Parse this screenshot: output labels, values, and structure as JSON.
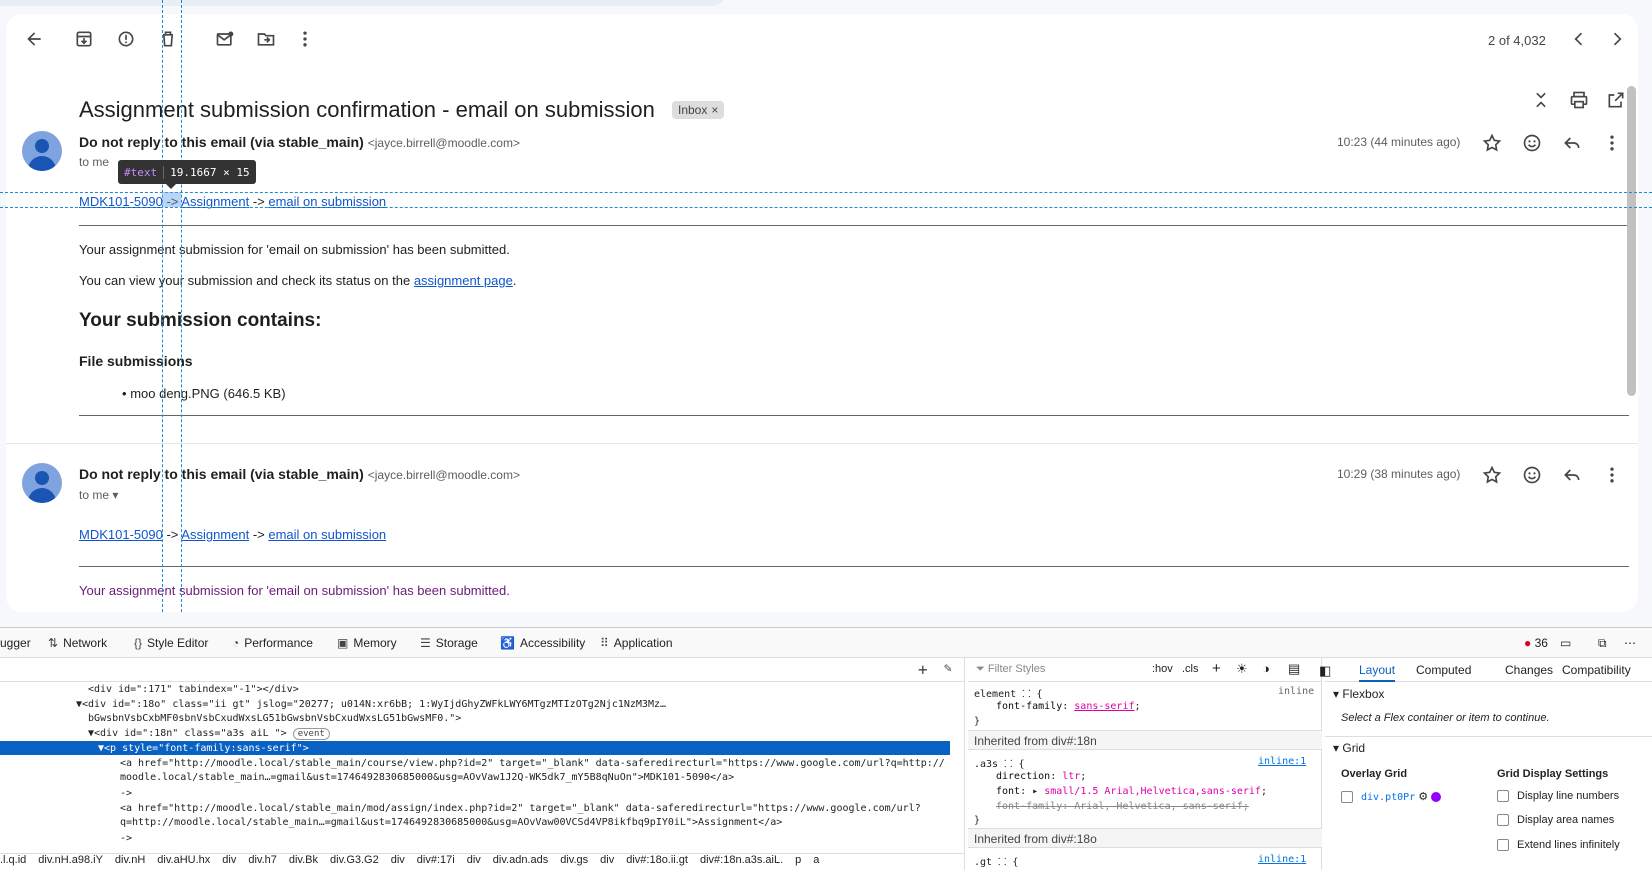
{
  "toolbar": {
    "back_icon": "arrow-back-icon",
    "pager_text": "2 of 4,032"
  },
  "subject": "Assignment submission confirmation - email on submission",
  "label_chip": {
    "text": "Inbox",
    "close": "×"
  },
  "messages": [
    {
      "sender": "Do not reply to this email (via stable_main)",
      "address": "<jayce.birrell@moodle.com>",
      "to": "to me",
      "time": "10:23 (44 minutes ago)",
      "breadcrumb": {
        "course": "MDK101-5090",
        "sep": "->",
        "assign": "Assignment",
        "item": "email on submission"
      },
      "body1": "Your assignment submission for 'email on submission' has been submitted.",
      "body2_pre": "You can view your submission and check its status on the",
      "body2_link": "assignment page",
      "body2_post": ".",
      "heading": "Your submission contains:",
      "subheading": "File submissions",
      "file": "moo deng.PNG (646.5 KB)"
    },
    {
      "sender": "Do not reply to this email (via stable_main)",
      "address": "<jayce.birrell@moodle.com>",
      "to": "to me",
      "time": "10:29 (38 minutes ago)",
      "breadcrumb": {
        "course": "MDK101-5090",
        "sep": "->",
        "assign": "Assignment",
        "item": "email on submission"
      },
      "body1": "Your assignment submission for 'email on submission' has been submitted."
    }
  ],
  "inspector_tooltip": {
    "tag": "#text",
    "dims": "19.1667 × 15"
  },
  "devtools": {
    "tabs": [
      "ugger",
      "Network",
      "Style Editor",
      "Performance",
      "Memory",
      "Storage",
      "Accessibility",
      "Application"
    ],
    "error_count": "36",
    "html_lines": [
      "<div id=\":171\" tabindex=\"-1\"></div>",
      "▼<div id=\":18o\" class=\"ii gt\" jslog=\"20277; u014N:xr6bB; 1:WyIjdGhyZWFkLWY6MTgzMTIzOTg2Njc1NzM3Mz…",
      "  bGwsbnVsbCxbMF0sbnVsbCxudWxsLG51bGwsbnVsbCxudWxsLG51bGwsMF0.\">",
      "▼<div id=\":18n\" class=\"a3s aiL \">",
      "▼<p style=\"font-family:sans-serif\">",
      "<a href=\"http://moodle.local/stable_main/course/view.php?id=2\" target=\"_blank\" data-saferedirecturl=\"https://www.google.com/url?q=http://",
      "moodle.local/stable_main…=gmail&ust=1746492830685000&usg=AOvVaw1J2Q-WK5dk7_mY5B8qNuOn\">MDK101-5090</a>",
      "->",
      "<a href=\"http://moodle.local/stable_main/mod/assign/index.php?id=2\" target=\"_blank\" data-saferedirecturl=\"https://www.google.com/url?",
      "q=http://moodle.local/stable_main…=gmail&ust=1746492830685000&usg=AOvVaw00VCSd4VP8ikfbq9pIY0iL\">Assignment</a>",
      "->"
    ],
    "event_badge": "event",
    "breadcrumbs": [
      ".l.q.id",
      "div.nH.a98.iY",
      "div.nH",
      "div.aHU.hx",
      "div",
      "div.h7",
      "div.Bk",
      "div.G3.G2",
      "div",
      "div#:17i",
      "div",
      "div.adn.ads",
      "div.gs",
      "div",
      "div#:18o.ii.gt",
      "div#:18n.a3s.aiL.",
      "p",
      "a"
    ],
    "styles": {
      "filter_placeholder": "Filter Styles",
      "hov": ":hov",
      "cls": ".cls",
      "element_sel": "element",
      "inline": "inline",
      "ff_prop": "font-family",
      "ff_val": "sans-serif",
      "inh1": "Inherited from div#:18n",
      "a3s_sel": ".a3s",
      "inline1": "inline:1",
      "dir_prop": "direction",
      "dir_val": "ltr",
      "font_prop": "font",
      "font_val": "small/1.5 Arial,Helvetica,sans-serif",
      "ff2": "font-family: Arial, Helvetica, sans-serif;",
      "inh2": "Inherited from div#:18o",
      "gt_sel": ".gt",
      "inline2": "inline:1"
    },
    "layout": {
      "tabs": [
        "Layout",
        "Computed",
        "Changes",
        "Compatibility"
      ],
      "flexbox": "Flexbox",
      "flex_hint": "Select a Flex container or item to continue.",
      "grid": "Grid",
      "overlay_grid": "Overlay Grid",
      "grid_item": "div.pt0Pr",
      "grid_display": "Grid Display Settings",
      "opt1": "Display line numbers",
      "opt2": "Display area names",
      "opt3": "Extend lines infinitely"
    }
  }
}
